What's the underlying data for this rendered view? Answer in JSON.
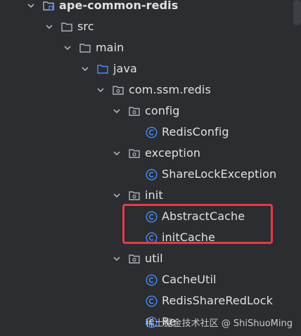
{
  "tree": {
    "root": {
      "label": "ape-common-redis",
      "icon": "module-folder-icon"
    },
    "items": [
      {
        "label": "src",
        "icon": "folder-icon"
      },
      {
        "label": "main",
        "icon": "folder-icon"
      },
      {
        "label": "java",
        "icon": "source-folder-icon"
      },
      {
        "label": "com.ssm.redis",
        "icon": "package-icon"
      },
      {
        "label": "config",
        "icon": "package-icon"
      },
      {
        "label": "RedisConfig",
        "icon": "class-icon"
      },
      {
        "label": "exception",
        "icon": "package-icon"
      },
      {
        "label": "ShareLockException",
        "icon": "class-icon"
      },
      {
        "label": "init",
        "icon": "package-icon"
      },
      {
        "label": "AbstractCache",
        "icon": "class-icon"
      },
      {
        "label": "initCache",
        "icon": "class-icon"
      },
      {
        "label": "util",
        "icon": "package-icon"
      },
      {
        "label": "CacheUtil",
        "icon": "class-icon"
      },
      {
        "label": "RedisShareRedLock",
        "icon": "class-icon"
      },
      {
        "label": "Re",
        "icon": "class-icon"
      }
    ]
  },
  "watermark": "稀土掘金技术社区 @ ShiShuoMing",
  "colors": {
    "background": "#2b2d30",
    "text": "#dfe1e5",
    "class_icon": "#4a8cf7",
    "highlight_border": "#e8394b",
    "source_folder": "#4a8cf7"
  }
}
